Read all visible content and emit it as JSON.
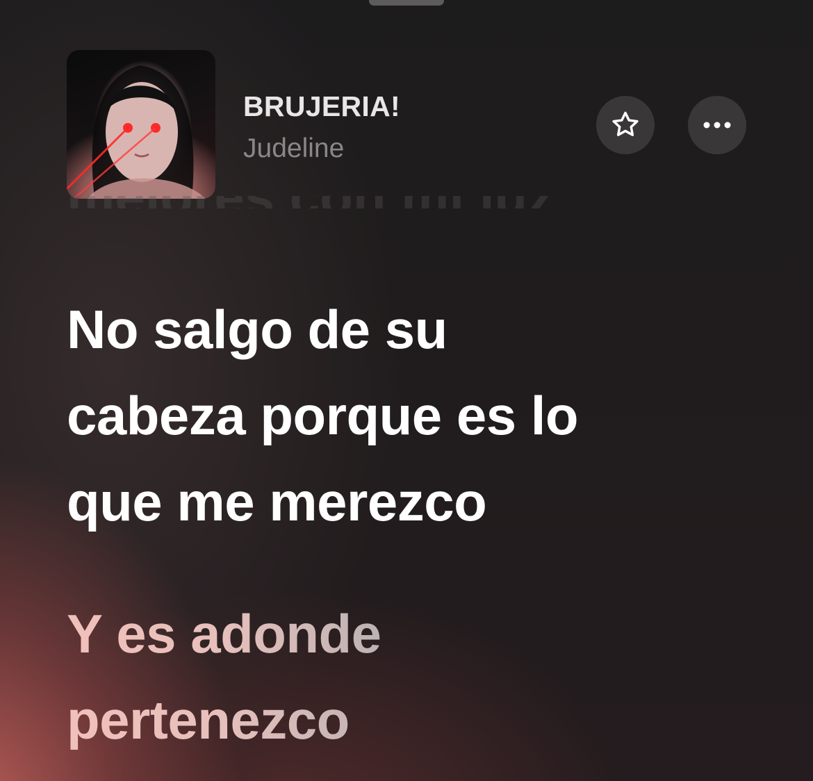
{
  "now_playing": {
    "title": "BRUJERIA!",
    "artist": "Judeline",
    "artwork_icon": "album-artwork"
  },
  "actions": {
    "favorite_icon": "star-icon",
    "more_icon": "ellipsis-icon"
  },
  "lyrics": {
    "previous_line": "mejores con mi luz",
    "current": [
      "No salgo de su",
      "cabeza porque es lo",
      "que me merezco"
    ],
    "next": [
      "Y es adonde",
      "pertenezco"
    ]
  },
  "colors": {
    "background": "#1d1b1c",
    "accent_glow": "#c4625c",
    "current_lyric": "#ffffff",
    "title": "#e9e6e7",
    "artist": "#8a8788",
    "button_bg": "#3a3738"
  }
}
